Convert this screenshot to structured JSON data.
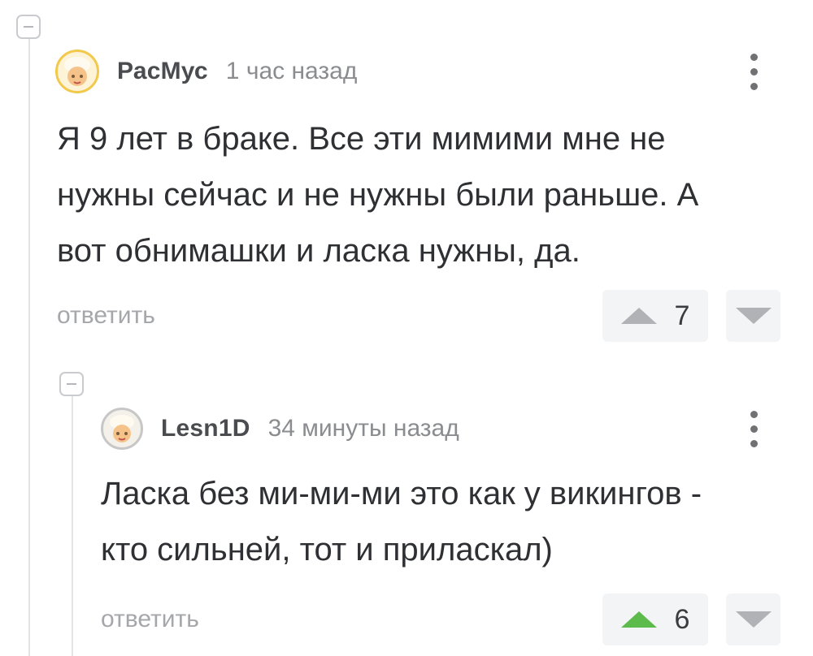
{
  "comments": [
    {
      "author": "РасМус",
      "time": "1 час назад",
      "text": "Я 9 лет в браке. Все эти мимими мне не\nнужны сейчас и не нужны были раньше. А\nвот обнимашки и ласка нужны, да.",
      "reply_label": "ответить",
      "rating": "7",
      "upvoted": false
    },
    {
      "author": "Lesn1D",
      "time": "34 минуты назад",
      "text": "Ласка без ми-ми-ми это как у викингов -\nкто сильней, тот и приласкал)",
      "reply_label": "ответить",
      "rating": "6",
      "upvoted": true
    }
  ],
  "colors": {
    "upvote_active": "#5dbb4c",
    "vote_inactive": "#b0b2b6",
    "avatar_border_gold": "#f2c94c"
  },
  "icons": [
    "collapse-icon",
    "avatar-icon",
    "more-options-icon",
    "upvote-icon",
    "downvote-icon"
  ]
}
